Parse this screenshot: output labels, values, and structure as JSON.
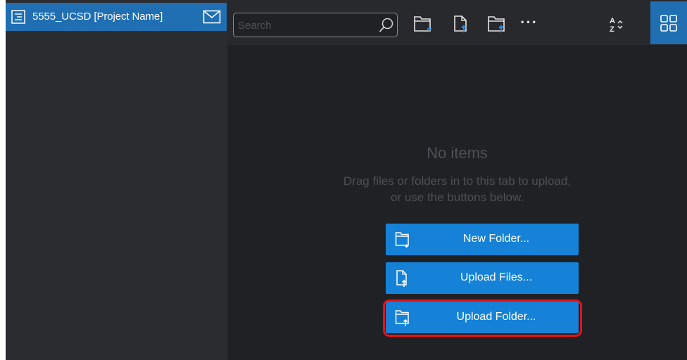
{
  "sidebar": {
    "project_name": "5555_UCSD [Project Name]",
    "project_icon": "project-doc-icon",
    "mail_icon": "mail-icon"
  },
  "toolbar": {
    "search_placeholder": "Search",
    "search_value": "",
    "buttons": [
      "new-folder-icon",
      "upload-file-icon",
      "upload-folder-icon",
      "more-icon",
      "sort-az-icon",
      "grid-view-icon"
    ],
    "more_label": "···"
  },
  "main": {
    "empty_title": "No items",
    "empty_hint_line1": "Drag files or folders in to this tab to upload,",
    "empty_hint_line2": "or use the buttons below.",
    "actions": {
      "new_folder": "New Folder...",
      "upload_files": "Upload Files...",
      "upload_folder": "Upload Folder..."
    }
  },
  "colors": {
    "accent": "#1f6fb2",
    "button_blue": "#1582d8",
    "highlight_red": "#e8111a",
    "background": "#202124",
    "sidebar_bg": "#2b2c2f"
  }
}
